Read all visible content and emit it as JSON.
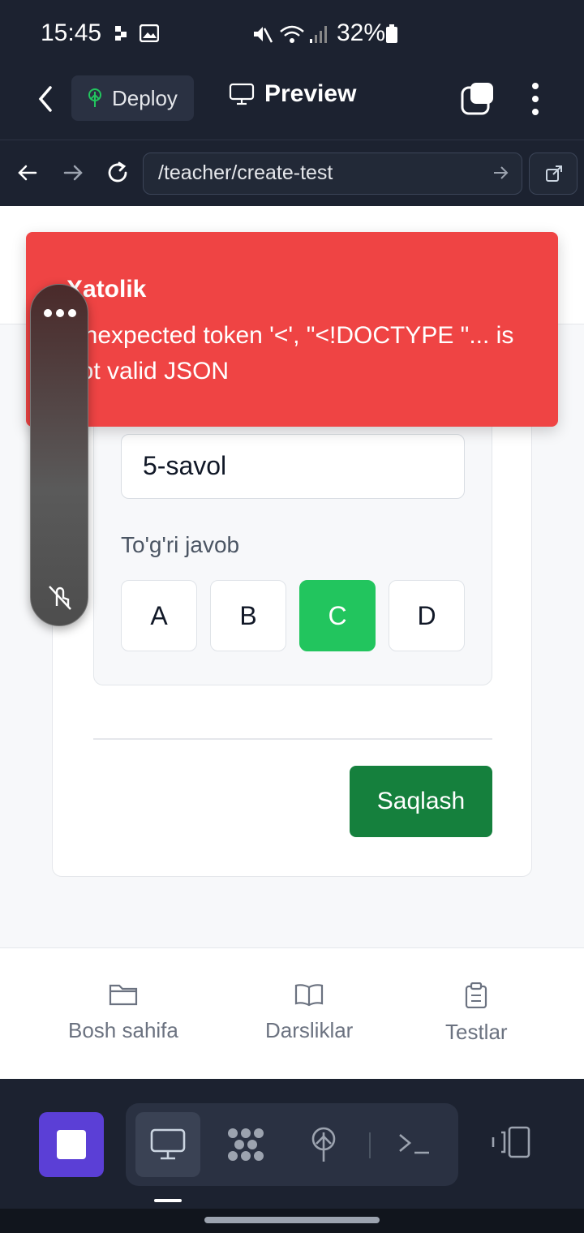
{
  "status_bar": {
    "time": "15:45",
    "battery": "32%"
  },
  "app_header": {
    "deploy_label": "Deploy",
    "preview_label": "Preview"
  },
  "browser": {
    "url": "/teacher/create-test"
  },
  "toast": {
    "title": "Xatolik",
    "message": "Unexpected token '<', \"<!DOCTYPE \"... is not valid JSON",
    "color": "#ef4444"
  },
  "question": {
    "text": "5-savol",
    "answer_label": "To'g'ri javob",
    "options": [
      "A",
      "B",
      "C",
      "D"
    ],
    "selected": "C"
  },
  "save_label": "Saqlash",
  "bottom_nav": [
    {
      "label": "Bosh sahifa",
      "icon": "folder-icon"
    },
    {
      "label": "Darsliklar",
      "icon": "book-icon"
    },
    {
      "label": "Testlar",
      "icon": "clipboard-icon"
    }
  ],
  "colors": {
    "accent": "#22c55e",
    "save": "#15803d",
    "stop": "#5b3fd6"
  }
}
